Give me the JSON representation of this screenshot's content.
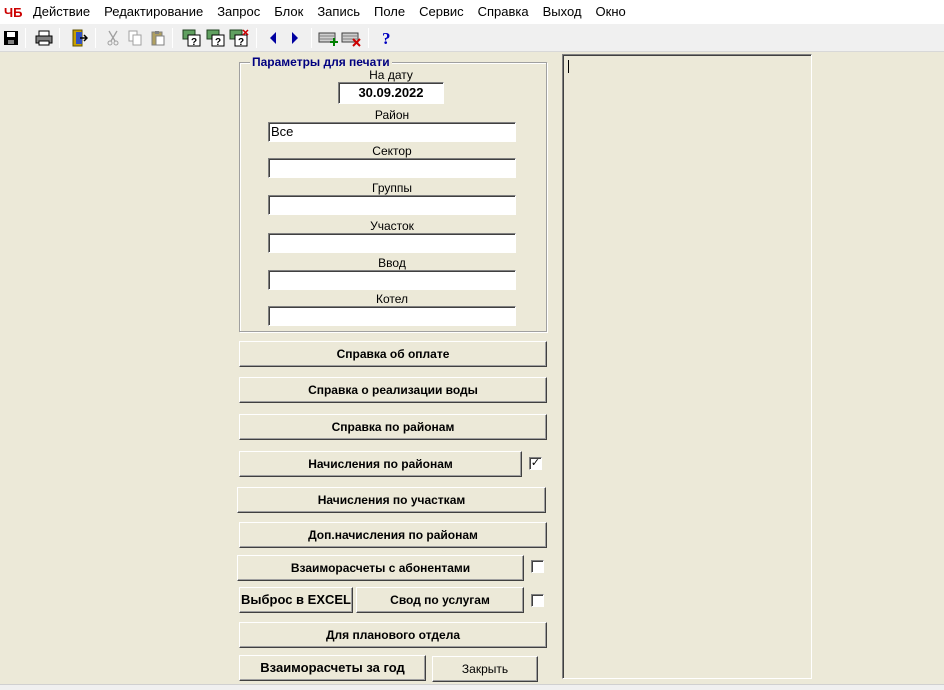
{
  "menubar": {
    "app_icon": "app-logo-icon",
    "items": [
      "Действие",
      "Редактирование",
      "Запрос",
      "Блок",
      "Запись",
      "Поле",
      "Сервис",
      "Справка",
      "Выход",
      "Окно"
    ]
  },
  "toolbar": {
    "icons": [
      "save-icon",
      "print-icon",
      "exit-door-icon",
      "cut-icon",
      "copy-icon",
      "paste-icon",
      "query-icon",
      "query-run-icon",
      "query-cancel-icon",
      "prev-record-icon",
      "next-record-icon",
      "insert-record-icon",
      "delete-record-icon",
      "help-icon"
    ]
  },
  "params": {
    "group_title": "Параметры для печати",
    "date_label": "На дату",
    "date_value": "30.09.2022",
    "district_label": "Район",
    "district_value": "Все",
    "sector_label": "Сектор",
    "sector_value": "",
    "groups_label": "Группы",
    "groups_value": "",
    "plot_label": "Участок",
    "plot_value": "",
    "input_label": "Ввод",
    "input_value": "",
    "boiler_label": "Котел",
    "boiler_value": ""
  },
  "buttons": {
    "payment_ref": "Справка об оплате",
    "water_sales_ref": "Справка о реализации воды",
    "district_ref": "Справка по районам",
    "charges_district": "Начисления по районам",
    "charges_plots": "Начисления по участкам",
    "extra_charges_district": "Доп.начисления по районам",
    "subscriber_settlements": "Взаиморасчеты с абонентами",
    "export_excel": "Выброс в EXCEL",
    "services_summary": "Свод по услугам",
    "planning_dept": "Для планового отдела",
    "yearly_settlements": "Взаиморасчеты за год",
    "close": "Закрыть"
  },
  "checkboxes": {
    "charges_district_checked": true,
    "subscriber_settlements_checked": false,
    "services_summary_checked": false
  },
  "text_pane": {
    "content": ""
  }
}
